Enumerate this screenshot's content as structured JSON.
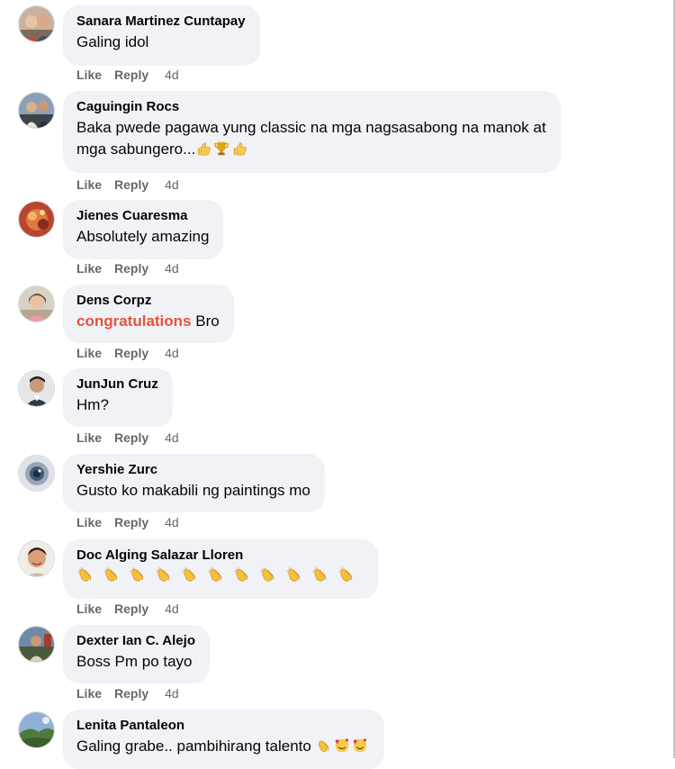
{
  "actions": {
    "like": "Like",
    "reply": "Reply"
  },
  "comments": [
    {
      "author": "Sanara Martinez Cuntapay",
      "text": "Galing idol",
      "time": "4d"
    },
    {
      "author": "Caguingin Rocs",
      "text": "Baka pwede pagawa yung classic na mga nagsasabong na manok at",
      "text2": "mga sabungero...",
      "time": "4d"
    },
    {
      "author": "Jienes Cuaresma",
      "text": "Absolutely amazing",
      "time": "4d"
    },
    {
      "author": "Dens Corpz",
      "highlight": "congratulations",
      "text": "Bro",
      "time": "4d"
    },
    {
      "author": "JunJun Cruz",
      "text": "Hm?",
      "time": "4d"
    },
    {
      "author": "Yershie Zurc",
      "text": "Gusto ko makabili ng paintings mo",
      "time": "4d"
    },
    {
      "author": "Doc Alging Salazar Lloren",
      "clap_count": 11,
      "time": "4d"
    },
    {
      "author": "Dexter Ian C. Alejo",
      "text": "Boss Pm po tayo",
      "time": "4d"
    },
    {
      "author": "Lenita Pantaleon",
      "text": "Galing grabe.. pambihirang talento",
      "time": ""
    }
  ],
  "icons": {
    "thumbs": "thumbs-up-emoji",
    "trophy": "trophy-emoji",
    "clap": "clapping-hands-emoji",
    "heart_face": "smiling-face-with-hearts-emoji"
  },
  "colors": {
    "bubble": "#f0f2f5",
    "meta": "#65676b",
    "highlight": "#e4533f"
  }
}
